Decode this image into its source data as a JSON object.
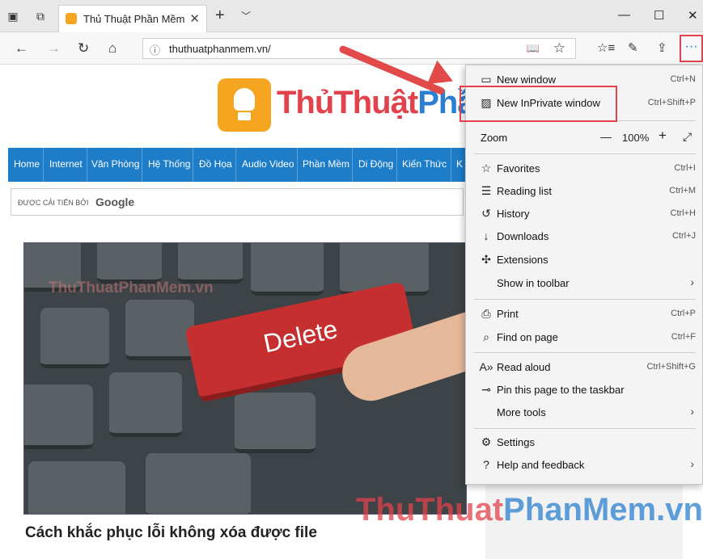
{
  "tab": {
    "title": "Thủ Thuật Phần Mềm, M"
  },
  "address": {
    "url": "thuthuatphanmem.vn/"
  },
  "site": {
    "logo_part1": "Thủ",
    "logo_part2": "Thuật",
    "logo_part3": "PhầnMề",
    "nav": [
      "Home",
      "Internet",
      "Văn Phòng",
      "Hệ Thống",
      "Đồ Họa",
      "Audio Video",
      "Phần Mềm",
      "Di Động",
      "Kiến Thức",
      "K"
    ],
    "search_label": "ĐƯỢC CẢI TIẾN BỞI",
    "search_brand": "Google",
    "image_key_text": "Delete",
    "image_watermark": "ThuThuatPhanMem.vn",
    "article_title": "Cách khắc phục lỗi không xóa được file",
    "watermark_a": "ThuThuat",
    "watermark_b": "PhanMem.vn"
  },
  "menu": {
    "new_window": "New window",
    "new_window_sc": "Ctrl+N",
    "new_inprivate": "New InPrivate window",
    "new_inprivate_sc": "Ctrl+Shift+P",
    "zoom_label": "Zoom",
    "zoom_value": "100%",
    "favorites": "Favorites",
    "favorites_sc": "Ctrl+I",
    "reading_list": "Reading list",
    "reading_list_sc": "Ctrl+M",
    "history": "History",
    "history_sc": "Ctrl+H",
    "downloads": "Downloads",
    "downloads_sc": "Ctrl+J",
    "extensions": "Extensions",
    "show_toolbar": "Show in toolbar",
    "print": "Print",
    "print_sc": "Ctrl+P",
    "find": "Find on page",
    "find_sc": "Ctrl+F",
    "read_aloud": "Read aloud",
    "read_aloud_sc": "Ctrl+Shift+G",
    "pin": "Pin this page to the taskbar",
    "more_tools": "More tools",
    "settings": "Settings",
    "help": "Help and feedback"
  },
  "colors": {
    "accent": "#e2424b",
    "nav_bg": "#1d7dc8",
    "logo": "#f5a51f"
  }
}
